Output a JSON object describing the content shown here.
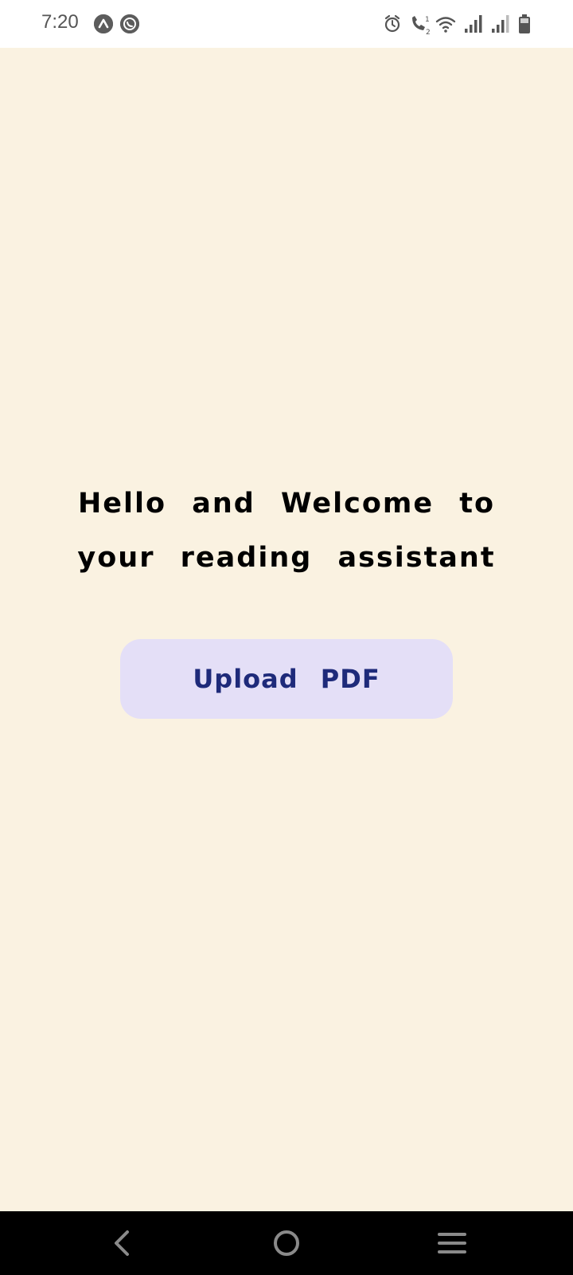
{
  "status_bar": {
    "time": "7:20",
    "notification_icons": [
      "arch-app-icon",
      "whatsapp-icon"
    ],
    "system_icons": [
      "alarm-icon",
      "wifi-call-icon",
      "wifi-icon",
      "signal-1-icon",
      "signal-2-icon",
      "battery-icon"
    ]
  },
  "main": {
    "welcome_text": "Hello and Welcome to your reading assistant",
    "upload_button_label": "Upload PDF"
  },
  "nav_bar": {
    "buttons": [
      "back-icon",
      "home-icon",
      "recents-icon"
    ]
  },
  "colors": {
    "background": "#faf2e1",
    "button_bg": "#e4dff7",
    "button_text": "#1e2a7a",
    "status_bar_bg": "#ffffff",
    "nav_bar_bg": "#000000"
  }
}
